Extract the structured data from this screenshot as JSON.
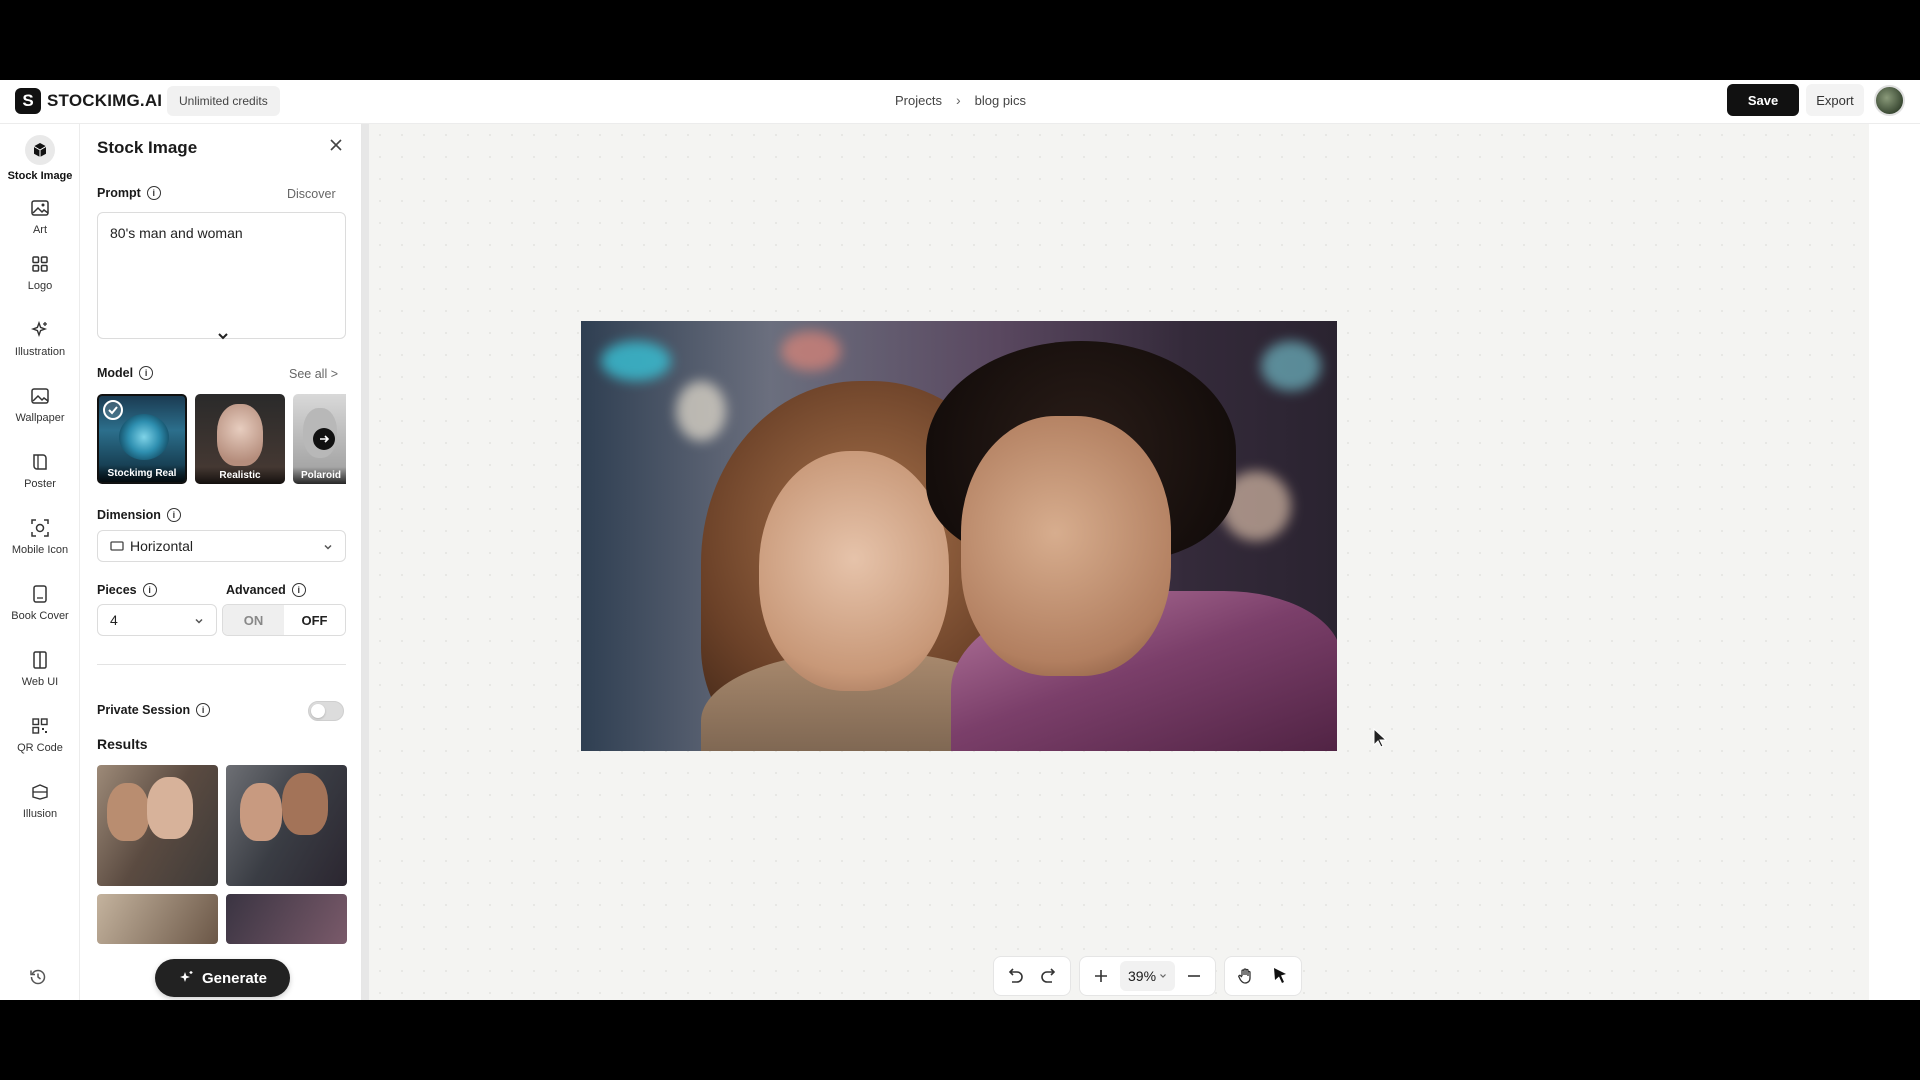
{
  "app": {
    "brand": "STOCKIMG.AI",
    "logo_glyph": "S",
    "credits": "Unlimited credits"
  },
  "breadcrumb": {
    "projects": "Projects",
    "separator": "›",
    "current": "blog pics"
  },
  "header": {
    "save_label": "Save",
    "export_label": "Export"
  },
  "rail": {
    "items": [
      {
        "label": "Stock Image",
        "icon": "cube-icon"
      },
      {
        "label": "Art",
        "icon": "image-icon"
      },
      {
        "label": "Logo",
        "icon": "grid-icon"
      },
      {
        "label": "Illustration",
        "icon": "sparkle-icon"
      },
      {
        "label": "Wallpaper",
        "icon": "image-icon"
      },
      {
        "label": "Poster",
        "icon": "book-icon"
      },
      {
        "label": "Mobile Icon",
        "icon": "app-icon"
      },
      {
        "label": "Book Cover",
        "icon": "book-cover-icon"
      },
      {
        "label": "Web UI",
        "icon": "layout-icon"
      },
      {
        "label": "QR Code",
        "icon": "qr-icon"
      },
      {
        "label": "Illusion",
        "icon": "illusion-icon"
      }
    ],
    "history_icon": "history-icon"
  },
  "panel": {
    "title": "Stock Image",
    "prompt": {
      "label": "Prompt",
      "discover": "Discover",
      "value": "80's man and woman"
    },
    "model": {
      "label": "Model",
      "see_all": "See all >",
      "options": [
        {
          "name": "Stockimg Real",
          "selected": true
        },
        {
          "name": "Realistic",
          "selected": false
        },
        {
          "name": "Polaroid",
          "selected": false
        }
      ]
    },
    "dimension": {
      "label": "Dimension",
      "value": "Horizontal"
    },
    "pieces": {
      "label": "Pieces",
      "value": "4"
    },
    "advanced": {
      "label": "Advanced",
      "on": "ON",
      "off": "OFF",
      "selected": "OFF"
    },
    "private_session": {
      "label": "Private Session",
      "enabled": false
    },
    "results": {
      "label": "Results",
      "count": 4
    },
    "generate_label": "Generate"
  },
  "canvas": {
    "zoom": "39%"
  },
  "colors": {
    "accent": "#111111",
    "canvas_bg": "#f4f4f2"
  }
}
